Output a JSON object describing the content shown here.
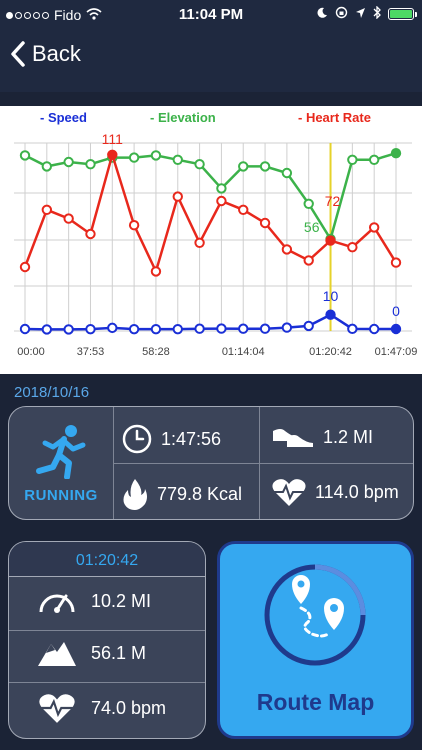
{
  "status_bar": {
    "carrier": "Fido",
    "time": "11:04 PM"
  },
  "nav": {
    "back_label": "Back"
  },
  "chart_data": {
    "type": "line",
    "x_ticks": [
      "00:00",
      "37:53",
      "58:28",
      "01:14:04",
      "01:20:42",
      "01:47:09"
    ],
    "series": [
      {
        "name": "- Speed",
        "color": "#1a2fd6",
        "values": [
          0,
          -0.3,
          -0.3,
          -0.1,
          0.8,
          -0.1,
          -0.1,
          -0.1,
          0.2,
          0.3,
          0.2,
          0.2,
          1.0,
          2.2,
          10.2,
          0.1,
          0,
          0
        ],
        "marker_label": "10",
        "end_label": "0"
      },
      {
        "name": "- Elevation",
        "color": "#3cb24a",
        "values": [
          78,
          73,
          75,
          74,
          77,
          77,
          78,
          76,
          74,
          63,
          73,
          73,
          70,
          56,
          40,
          76,
          76,
          79
        ],
        "marker_label": "56"
      },
      {
        "name": "- Heart Rate",
        "color": "#e8281c",
        "values": [
          60,
          86,
          82,
          75,
          111,
          79,
          58,
          92,
          71,
          90,
          86,
          80,
          68,
          63,
          72,
          69,
          78,
          62
        ],
        "marker_label": "111",
        "end_label": "72"
      }
    ],
    "highlight_index": 14,
    "grid": true
  },
  "session": {
    "date": "2018/10/16",
    "activity": "RUNNING",
    "duration": "1:47:56",
    "distance": "1.2 MI",
    "calories": "779.8 Kcal",
    "avg_heart_rate": "114.0 bpm"
  },
  "point": {
    "time": "01:20:42",
    "speed": "10.2 MI",
    "elevation": "56.1 M",
    "heart_rate": "74.0 bpm"
  },
  "route": {
    "label": "Route Map"
  },
  "colors": {
    "accent": "#35a8f0",
    "route_text": "#1f3a8c",
    "background": "#1b2336",
    "card": "#3b4459"
  },
  "icons": [
    "back-chevron-icon",
    "runner-icon",
    "clock-icon",
    "shoes-icon",
    "flame-icon",
    "heart-pulse-icon",
    "speedometer-icon",
    "mountain-icon",
    "route-map-icon"
  ]
}
